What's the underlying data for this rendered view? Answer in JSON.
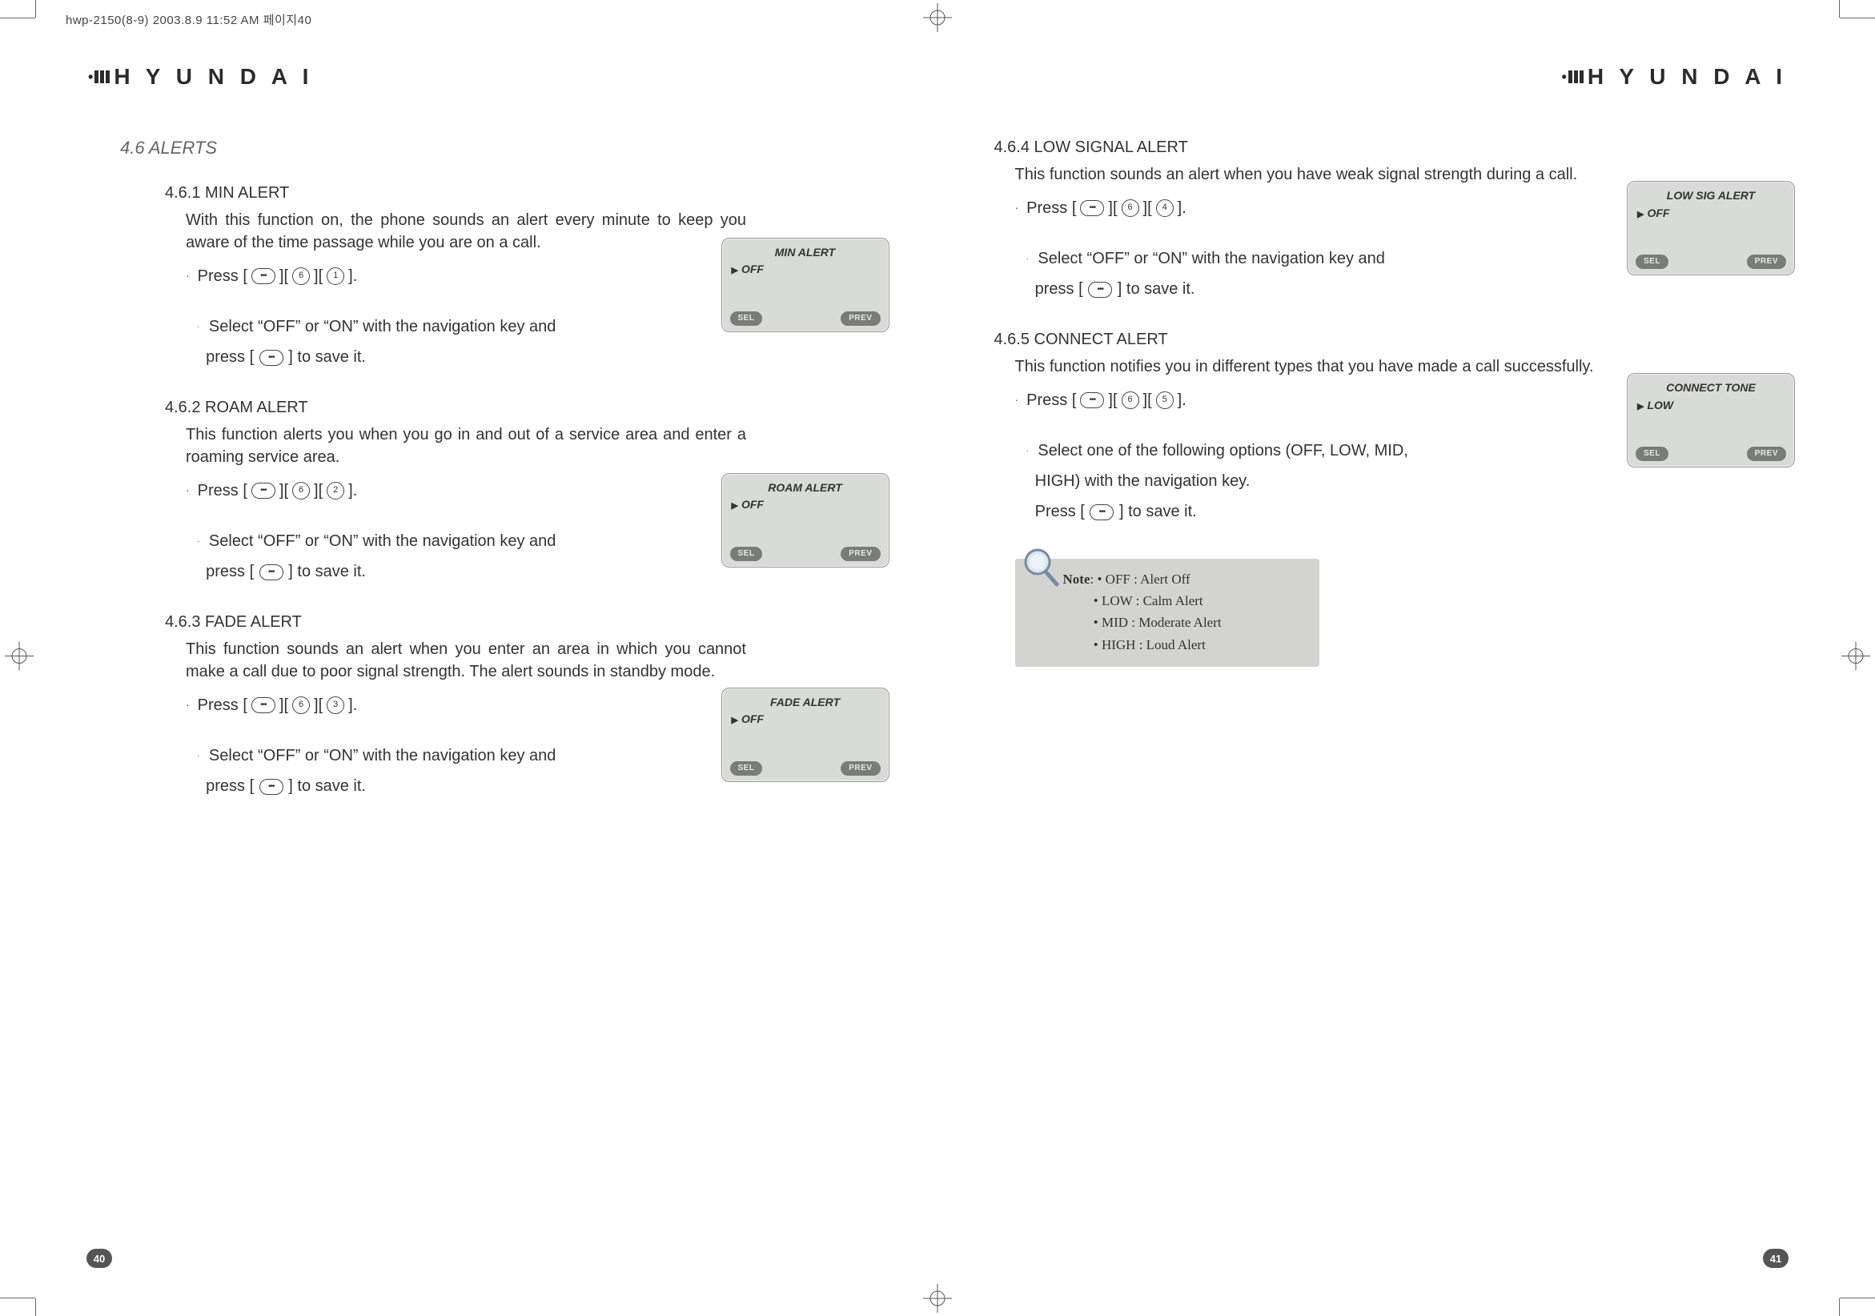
{
  "meta": {
    "header": "hwp-2150(8-9)  2003.8.9 11:52 AM 페이지40"
  },
  "brand": "H Y U N D A I",
  "left": {
    "section": "4.6 ALERTS",
    "s1": {
      "title": "4.6.1 MIN ALERT",
      "desc": "With this function on, the phone sounds an alert every minute to keep you aware of the time passage while you are on a call.",
      "press_prefix": "Press [",
      "press_suffix": "].",
      "k3": "1",
      "step2a": "Select “OFF” or “ON” with the navigation key and",
      "step2b": "press [",
      "step2c": "] to save it.",
      "screen_title": "MIN ALERT",
      "screen_value": "OFF"
    },
    "s2": {
      "title": "4.6.2 ROAM ALERT",
      "desc": "This function alerts you when you go in and out of a service area and enter a roaming service area.",
      "k3": "2",
      "screen_title": "ROAM ALERT",
      "screen_value": "OFF"
    },
    "s3": {
      "title": "4.6.3 FADE ALERT",
      "desc": "This function sounds an alert when you enter an area in which you cannot make a call due to poor signal strength. The alert sounds in standby mode.",
      "k3": "3",
      "screen_title": "FADE ALERT",
      "screen_value": "OFF"
    },
    "page_num": "40"
  },
  "right": {
    "s4": {
      "title": "4.6.4 LOW SIGNAL ALERT",
      "desc": "This function sounds an alert when you have weak signal strength during a call.",
      "k3": "4",
      "step2a": "Select “OFF” or “ON” with the navigation key and",
      "step2b": "press [",
      "step2c": "] to save it.",
      "screen_title": "LOW SIG ALERT",
      "screen_value": "OFF"
    },
    "s5": {
      "title": "4.6.5 CONNECT ALERT",
      "desc": "This function notifies you in different types that you have made a call successfully.",
      "k3": "5",
      "step2a": "Select one of the following options (OFF, LOW, MID,",
      "step2b": "HIGH) with the navigation key.",
      "step2c": "Press [",
      "step2d": "] to save it.",
      "screen_title": "CONNECT TONE",
      "screen_value": "LOW"
    },
    "note": {
      "label": "Note",
      "intro": ": ",
      "l1": "• OFF : Alert Off",
      "l2": "• LOW : Calm Alert",
      "l3": "• MID : Moderate Alert",
      "l4": "• HIGH : Loud Alert"
    },
    "page_num": "41"
  },
  "softkeys": {
    "left": "SEL",
    "right": "PREV"
  },
  "keys": {
    "menu_glyph": "•••",
    "six": "6"
  }
}
